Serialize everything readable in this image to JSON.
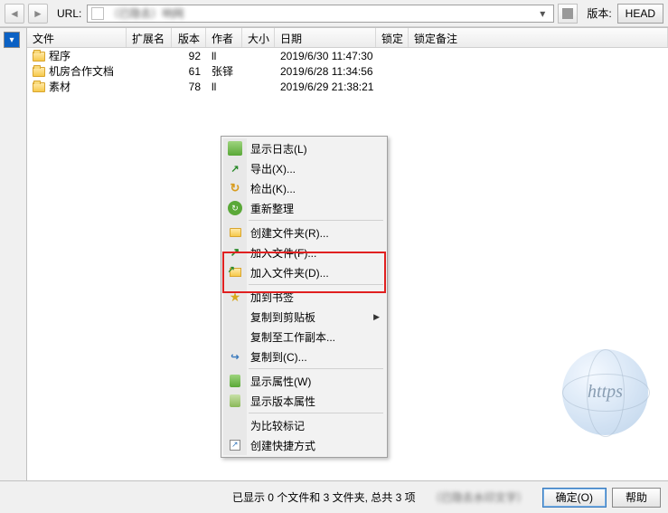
{
  "toolbar": {
    "url_label": "URL:",
    "url_value": "（已隐去）响网",
    "version_label": "版本:",
    "head_btn": "HEAD"
  },
  "columns": {
    "file": "文件",
    "ext": "扩展名",
    "rev": "版本",
    "author": "作者",
    "size": "大小",
    "date": "日期",
    "lock": "锁定",
    "lockmemo": "锁定备注"
  },
  "rows": [
    {
      "name": "程序",
      "rev": "92",
      "author": "ll",
      "date": "2019/6/30 11:47:30"
    },
    {
      "name": "机房合作文档",
      "rev": "61",
      "author": "张铎",
      "date": "2019/6/28 11:34:56"
    },
    {
      "name": "素材",
      "rev": "78",
      "author": "ll",
      "date": "2019/6/29 21:38:21"
    }
  ],
  "menu": {
    "show_log": "显示日志(L)",
    "export": "导出(X)...",
    "checkout": "检出(K)...",
    "refresh": "重新整理",
    "create_folder": "创建文件夹(R)...",
    "add_file": "加入文件(F)...",
    "add_folder": "加入文件夹(D)...",
    "add_bookmark": "加到书签",
    "copy_clipboard": "复制到剪贴板",
    "copy_wc": "复制至工作副本...",
    "copy_to": "复制到(C)...",
    "show_props": "显示属性(W)",
    "show_rev_props": "显示版本属性",
    "mark_compare": "为比较标记",
    "create_shortcut": "创建快捷方式"
  },
  "globe": {
    "text": "https"
  },
  "status": {
    "text": "已显示 0 个文件和 3 文件夹, 总共 3 项",
    "blur": "（已隐去水印文字）",
    "ok": "确定(O)",
    "help": "帮助"
  }
}
